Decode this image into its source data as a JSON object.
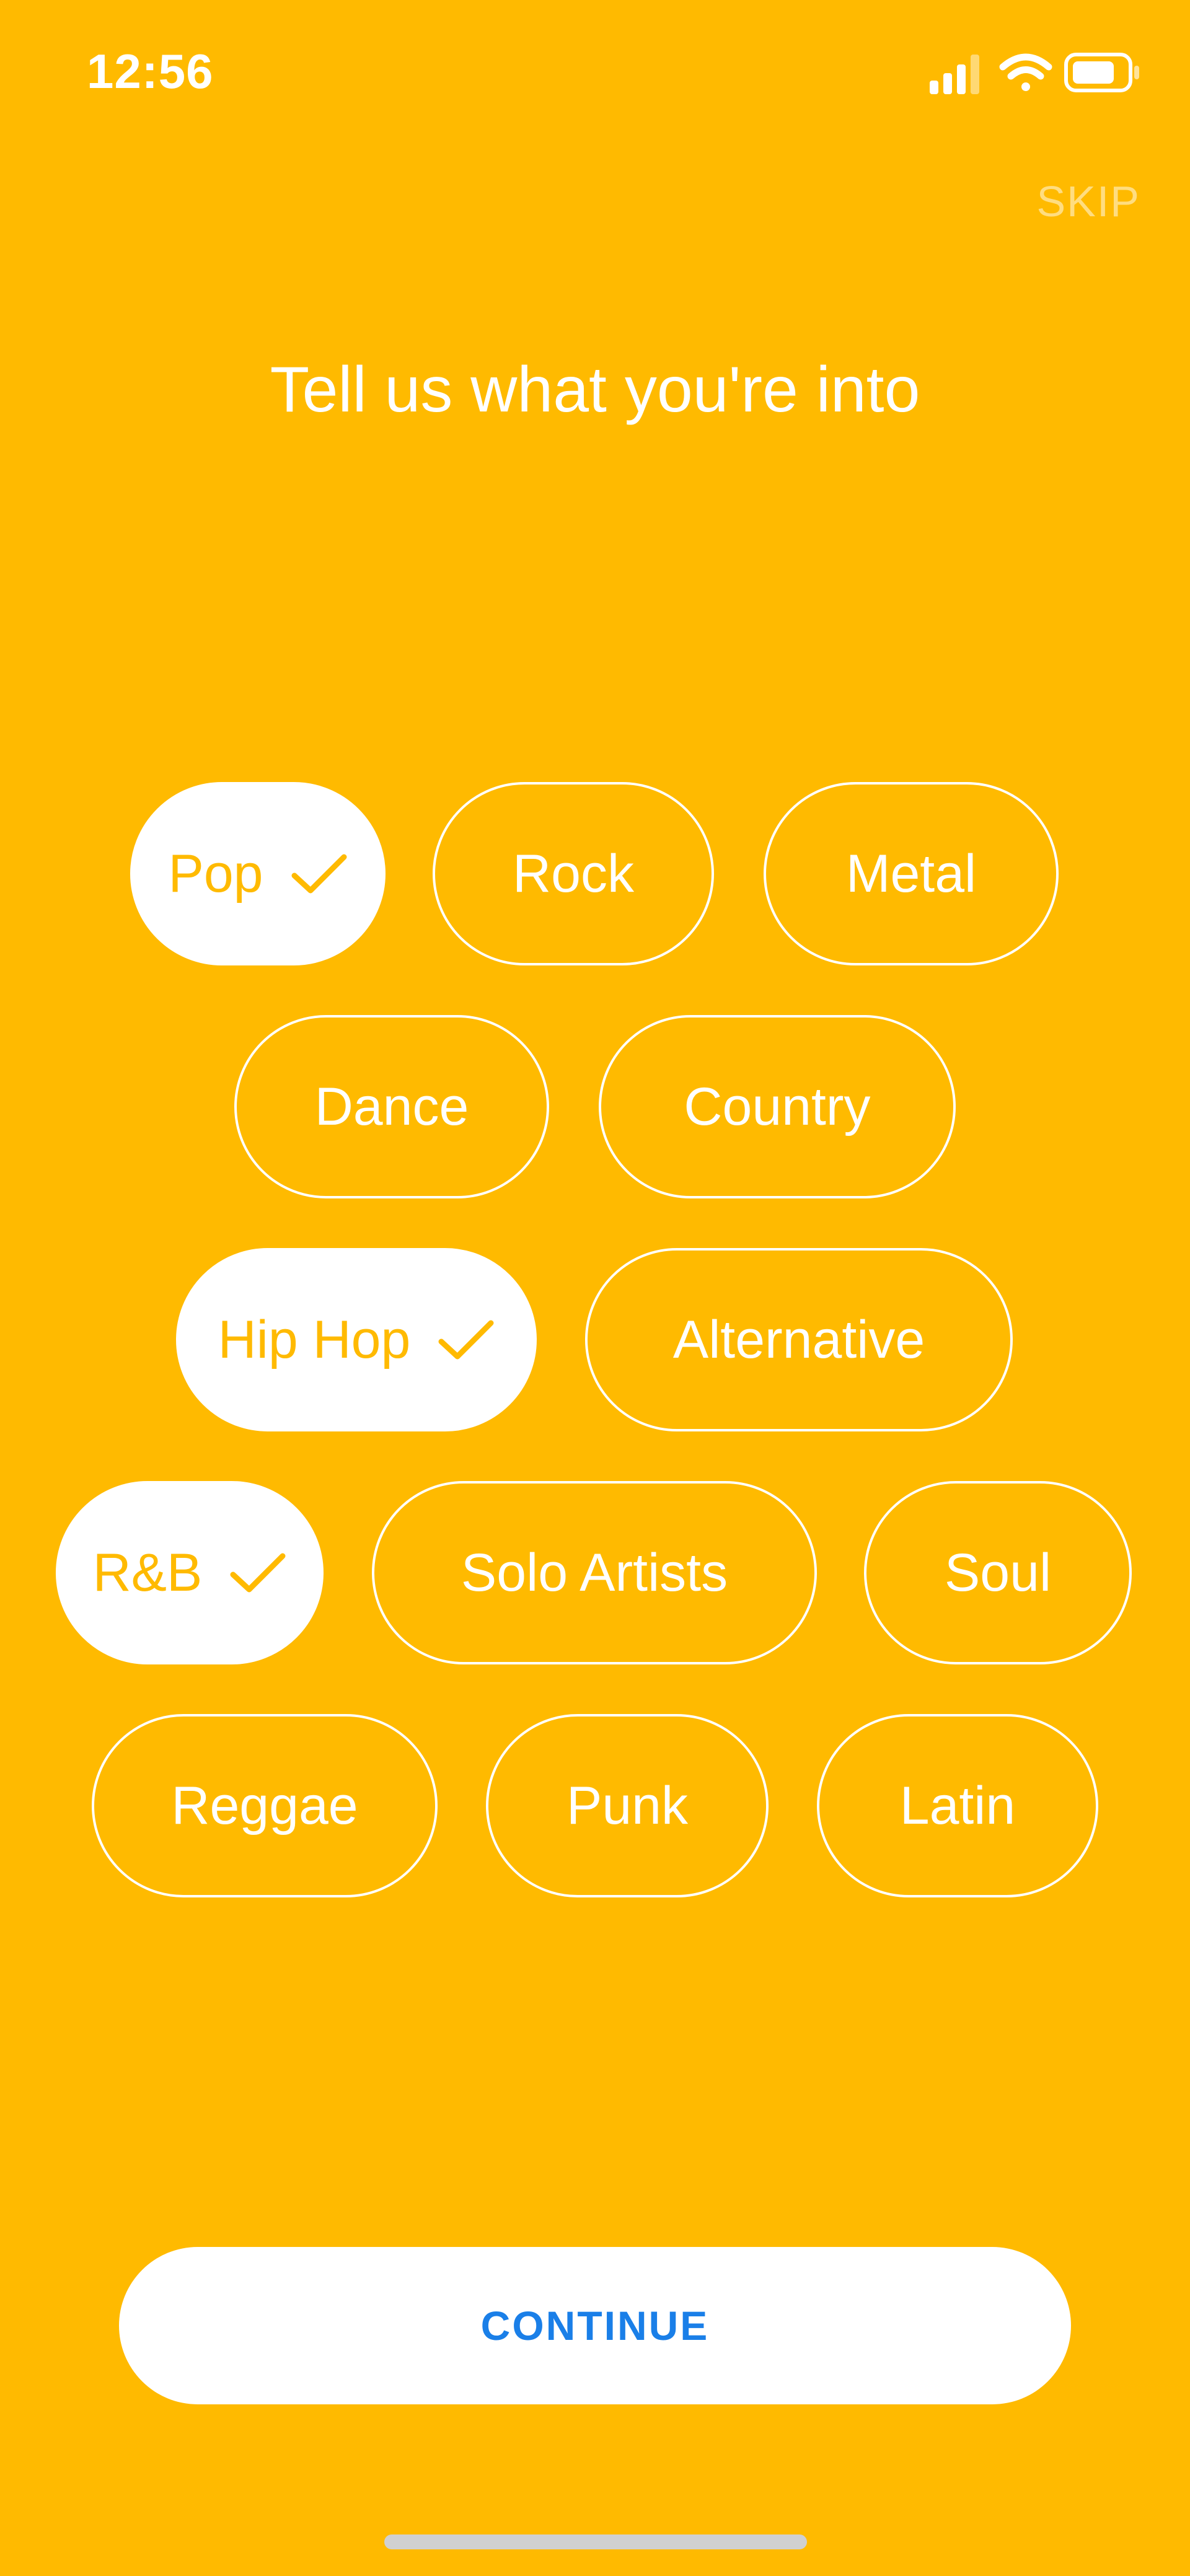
{
  "status_bar": {
    "time": "12:56"
  },
  "header": {
    "skip_label": "SKIP",
    "title": "Tell us what you're into"
  },
  "genres": [
    {
      "label": "Pop",
      "selected": true
    },
    {
      "label": "Rock",
      "selected": false
    },
    {
      "label": "Metal",
      "selected": false
    },
    {
      "label": "Dance",
      "selected": false
    },
    {
      "label": "Country",
      "selected": false
    },
    {
      "label": "Hip Hop",
      "selected": true
    },
    {
      "label": "Alternative",
      "selected": false
    },
    {
      "label": "R&B",
      "selected": true
    },
    {
      "label": "Solo Artists",
      "selected": false
    },
    {
      "label": "Soul",
      "selected": false
    },
    {
      "label": "Reggae",
      "selected": false
    },
    {
      "label": "Punk",
      "selected": false
    },
    {
      "label": "Latin",
      "selected": false
    }
  ],
  "footer": {
    "continue_label": "CONTINUE"
  },
  "colors": {
    "background": "#FFBA00",
    "continue_text": "#1A7FE8",
    "pill_selected_bg": "#FFFFFF"
  }
}
